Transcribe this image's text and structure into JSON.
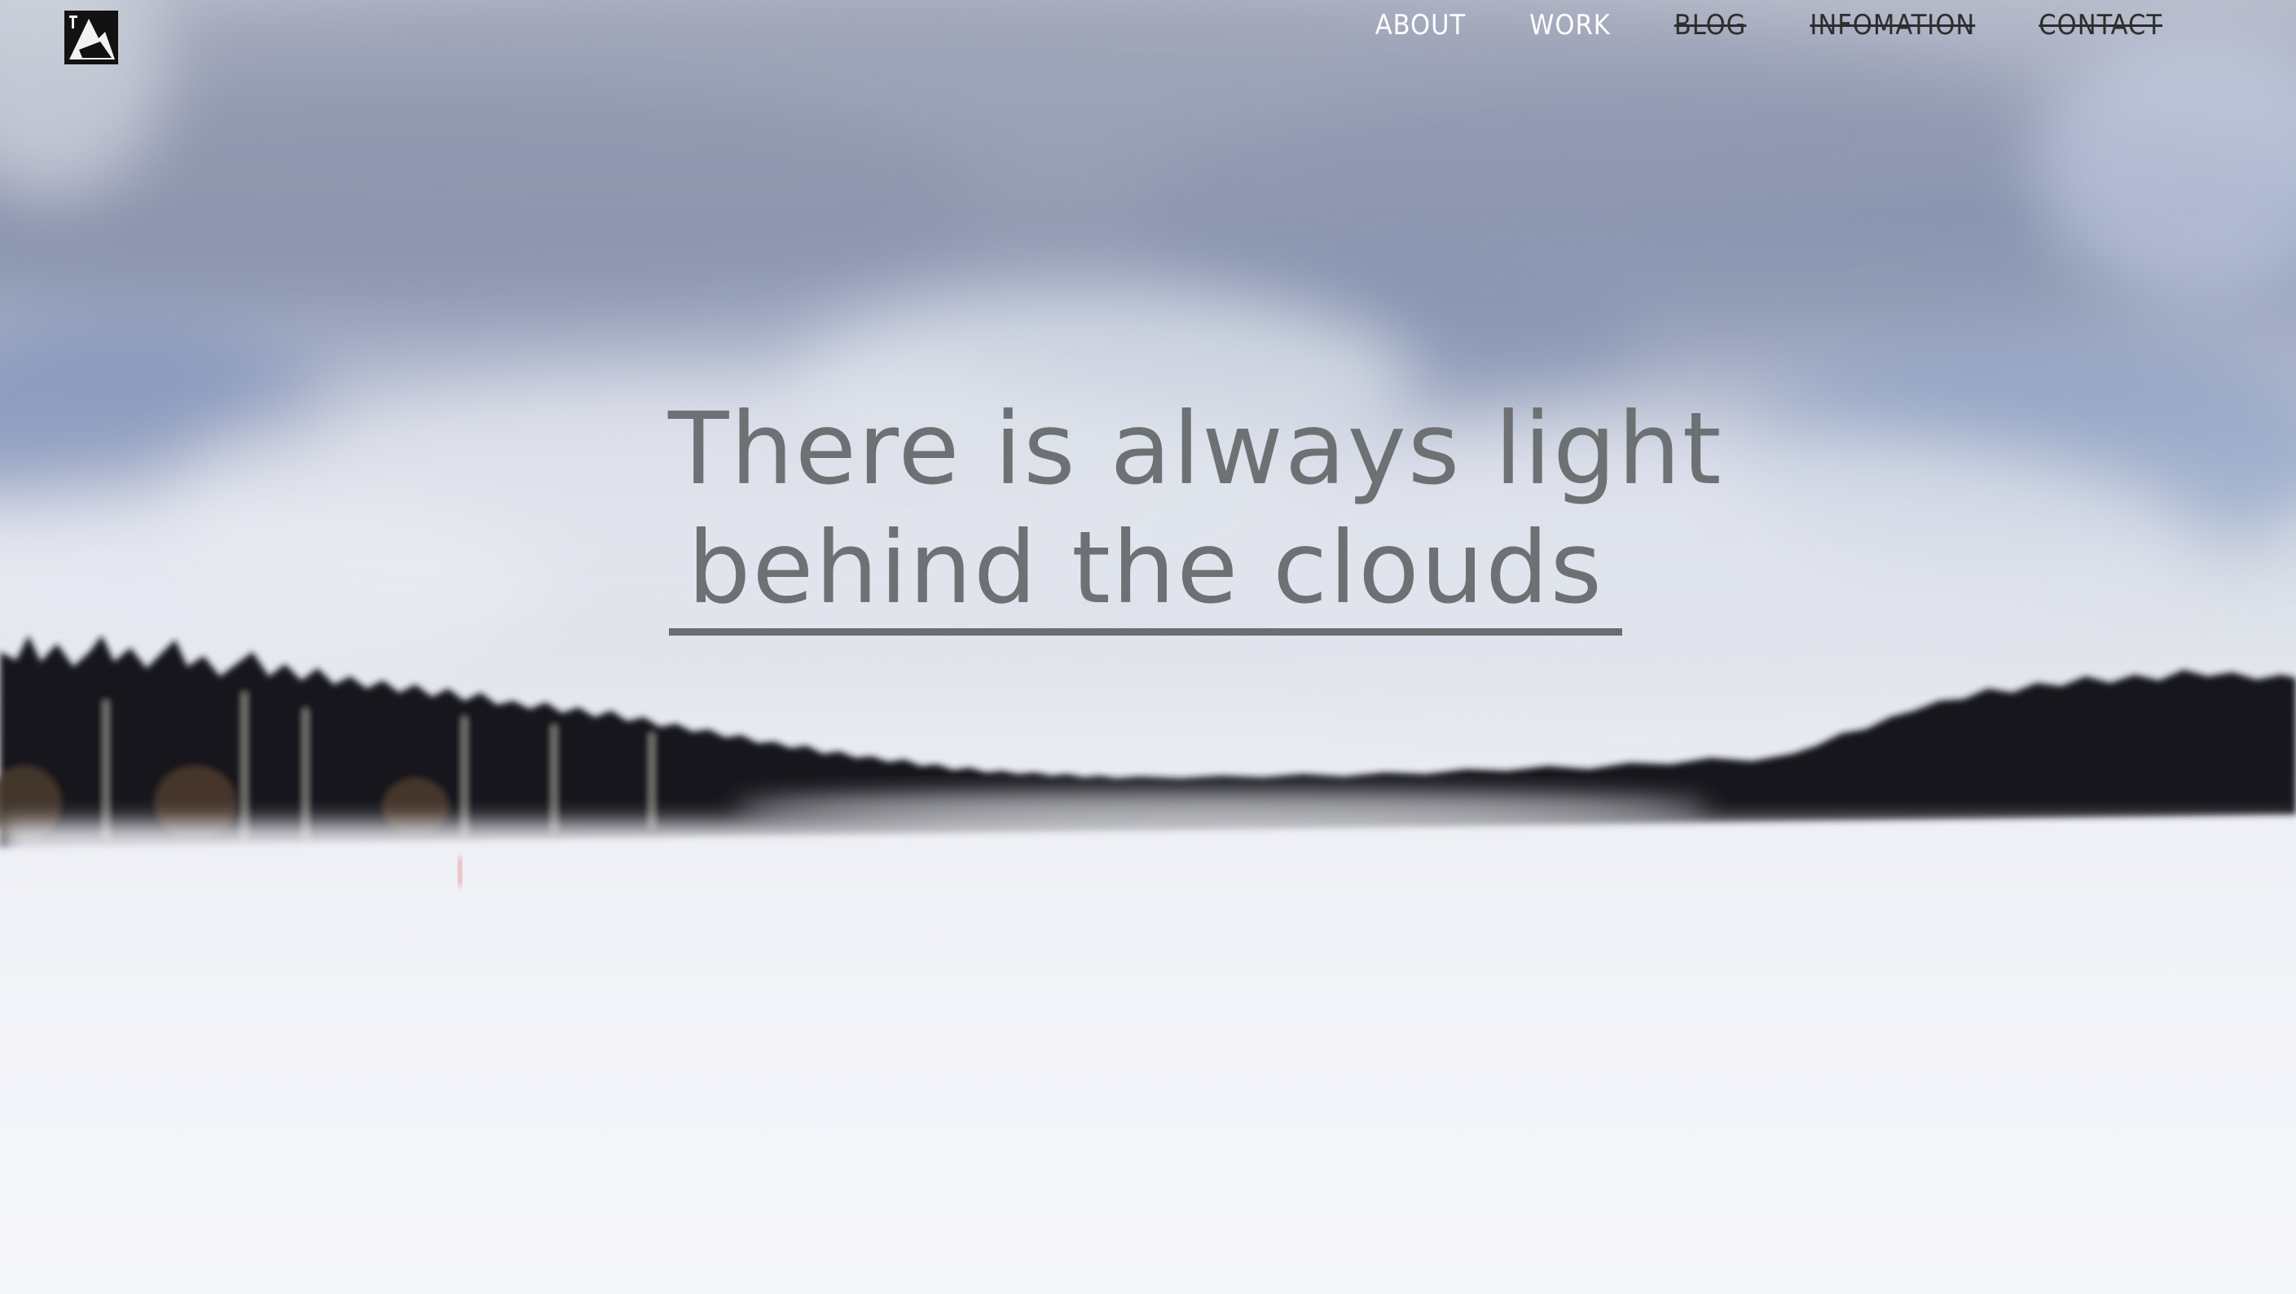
{
  "logo": {
    "icon": "mountain-logo-icon"
  },
  "nav": {
    "items": [
      {
        "label": "ABOUT",
        "style": "active"
      },
      {
        "label": "WORK",
        "style": "active"
      },
      {
        "label": "BLOG",
        "style": "struck"
      },
      {
        "label": "INFOMATION",
        "style": "struck"
      },
      {
        "label": "CONTACT",
        "style": "struck"
      }
    ]
  },
  "hero": {
    "line1": "There is always light",
    "line2": "behind the clouds"
  },
  "colors": {
    "heading": "#6e7173",
    "nav_light": "#ffffff",
    "nav_dark": "#2e2e2e"
  }
}
